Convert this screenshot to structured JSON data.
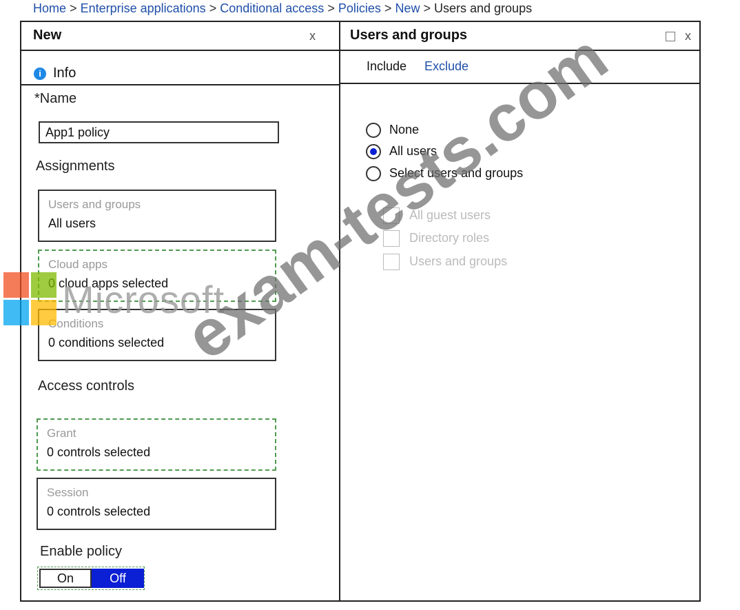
{
  "breadcrumb": {
    "items": [
      "Home",
      "Enterprise applications",
      "Conditional access",
      "Policies",
      "New"
    ],
    "current": "Users and groups",
    "separator": ">"
  },
  "left_blade": {
    "title": "New",
    "close_label": "x",
    "info_icon_glyph": "i",
    "info_label": "Info",
    "name_label": "*Name",
    "name_value": "App1 policy",
    "assignments_label": "Assignments",
    "cards": {
      "users": {
        "title": "Users and groups",
        "value": "All users"
      },
      "cloud_apps": {
        "title": "Cloud apps",
        "value": "0 cloud apps selected"
      },
      "conditions": {
        "title": "Conditions",
        "value": "0 conditions selected"
      },
      "grant": {
        "title": "Grant",
        "value": "0 controls selected"
      },
      "session": {
        "title": "Session",
        "value": "0 controls selected"
      }
    },
    "access_controls_label": "Access controls",
    "enable_policy_label": "Enable policy",
    "toggle": {
      "on_label": "On",
      "off_label": "Off",
      "selected": "Off"
    }
  },
  "right_blade": {
    "title": "Users and groups",
    "close_label": "x",
    "tabs": [
      {
        "label": "Include",
        "active": true
      },
      {
        "label": "Exclude",
        "active": false
      }
    ],
    "radio_options": [
      {
        "label": "None",
        "checked": false
      },
      {
        "label": "All users",
        "checked": true
      },
      {
        "label": "Select users and groups",
        "checked": false
      }
    ],
    "checkbox_options": [
      {
        "label": "All guest users",
        "checked": false,
        "disabled": true
      },
      {
        "label": "Directory roles",
        "checked": false,
        "disabled": true
      },
      {
        "label": "Users and groups",
        "checked": false,
        "disabled": true
      }
    ]
  },
  "overlays": {
    "ms_wordmark": "Microsoft",
    "watermark": "exam-tests.com"
  },
  "colors": {
    "link": "#1f4fa8",
    "toggle_off_bg": "#0b1fd4",
    "info_icon": "#1e88e5",
    "dashed_border": "#4f9a4f",
    "ms_red": "#f25022",
    "ms_green": "#7fba00",
    "ms_blue": "#00a4ef",
    "ms_yellow": "#ffb900"
  }
}
